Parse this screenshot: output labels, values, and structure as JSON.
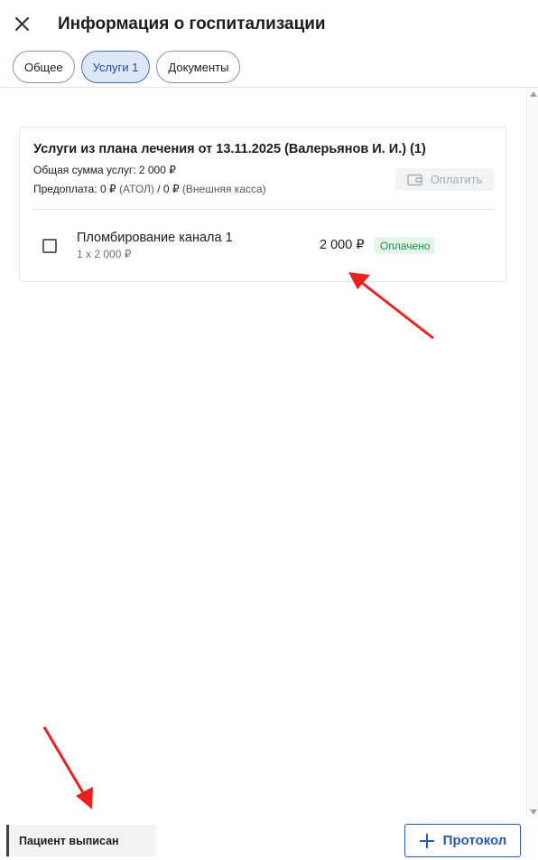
{
  "header": {
    "title": "Информация о госпитализации"
  },
  "tabs": [
    {
      "label": "Общее"
    },
    {
      "label": "Услуги 1"
    },
    {
      "label": "Документы"
    }
  ],
  "card": {
    "title": "Услуги из плана лечения от 13.11.2025 (Валерьянов И. И.) (1)",
    "total": "Общая сумма услуг: 2 000 ₽",
    "prepay_a": "Предоплата: 0 ₽",
    "prepay_a_note": "(АТОЛ)",
    "prepay_sep": "/ 0 ₽",
    "prepay_b_note": "(Внешняя касса)",
    "pay_button": "Оплатить"
  },
  "services": [
    {
      "name": "Пломбирование канала 1",
      "quantity": "1 x 2 000 ₽",
      "price": "2 000 ₽",
      "status": "Оплачено"
    }
  ],
  "footer": {
    "status": "Пациент выписан",
    "protocol_button": "Протокол"
  },
  "colors": {
    "accent": "#2a5aa8",
    "paid": "#268a4c",
    "annotation": "#e8201f"
  }
}
